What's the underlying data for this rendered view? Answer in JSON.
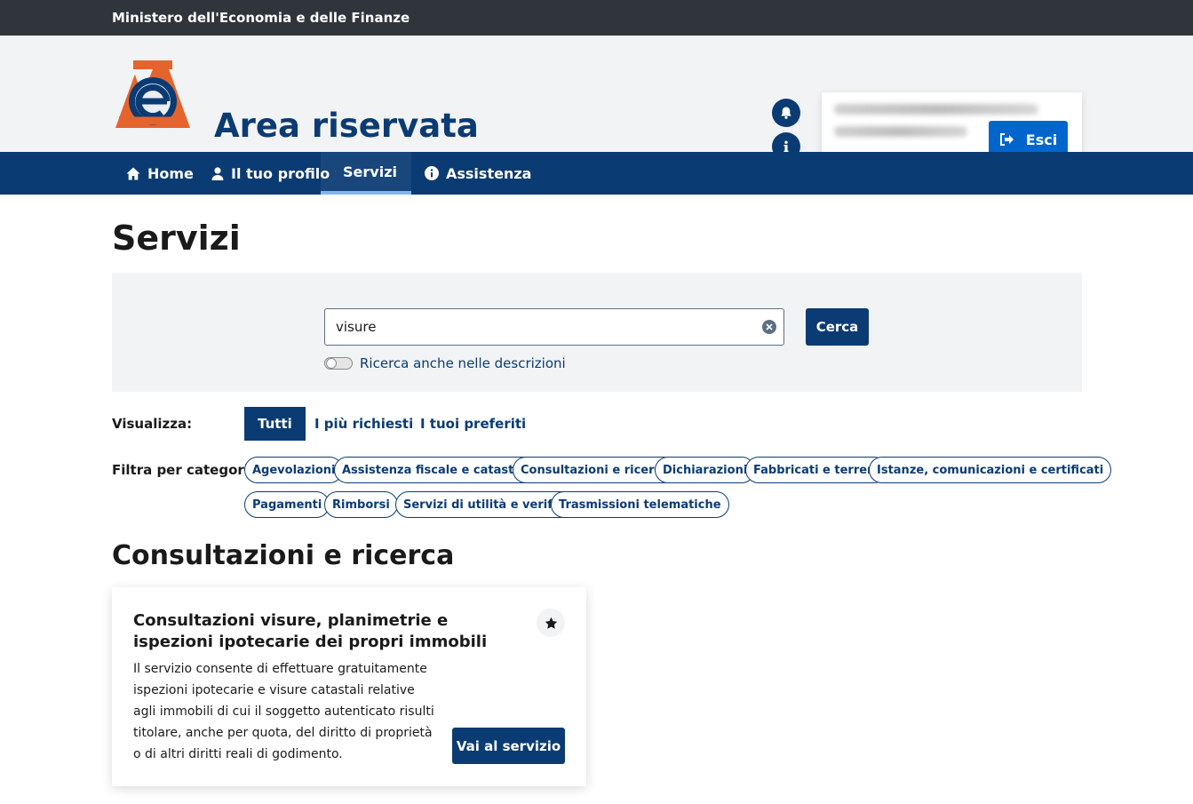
{
  "topbar": {
    "ministry": "Ministero dell'Economia e delle Finanze"
  },
  "header": {
    "title": "Area riservata",
    "logout_label": "Esci",
    "colors": {
      "brand": "#0b3b73",
      "accent": "#0066cc",
      "logo_orange": "#e5642c"
    }
  },
  "nav": {
    "items": [
      {
        "label": "Home",
        "icon": "home-icon"
      },
      {
        "label": "Il tuo profilo",
        "icon": "user-icon"
      },
      {
        "label": "Servizi",
        "icon": "services-icon",
        "active": true
      },
      {
        "label": "Assistenza",
        "icon": "info-icon"
      }
    ]
  },
  "page": {
    "title": "Servizi"
  },
  "search": {
    "value": "visure",
    "button_label": "Cerca",
    "toggle_label": "Ricerca anche nelle descrizioni",
    "toggle_on": false
  },
  "view": {
    "label": "Visualizza:",
    "options": [
      "Tutti",
      "I più richiesti",
      "I tuoi preferiti"
    ],
    "selected": "Tutti"
  },
  "filters": {
    "label": "Filtra per categoria:",
    "chips": [
      "Agevolazioni",
      "Assistenza fiscale e catastale",
      "Consultazioni e ricerca",
      "Dichiarazioni",
      "Fabbricati e terreni",
      "Istanze, comunicazioni e certificati",
      "Pagamenti",
      "Rimborsi",
      "Servizi di utilità e verifica",
      "Trasmissioni telematiche"
    ]
  },
  "section": {
    "title": "Consultazioni e ricerca"
  },
  "card": {
    "title": "Consultazioni visure, planimetrie e ispezioni ipotecarie dei propri immobili",
    "description": "Il servizio consente di effettuare gratuitamente ispezioni ipotecarie e visure catastali relative agli immobili di cui il soggetto autenticato risulti titolare, anche per quota, del diritto di proprietà o di altri diritti reali di godimento.",
    "button_label": "Vai al servizio"
  }
}
